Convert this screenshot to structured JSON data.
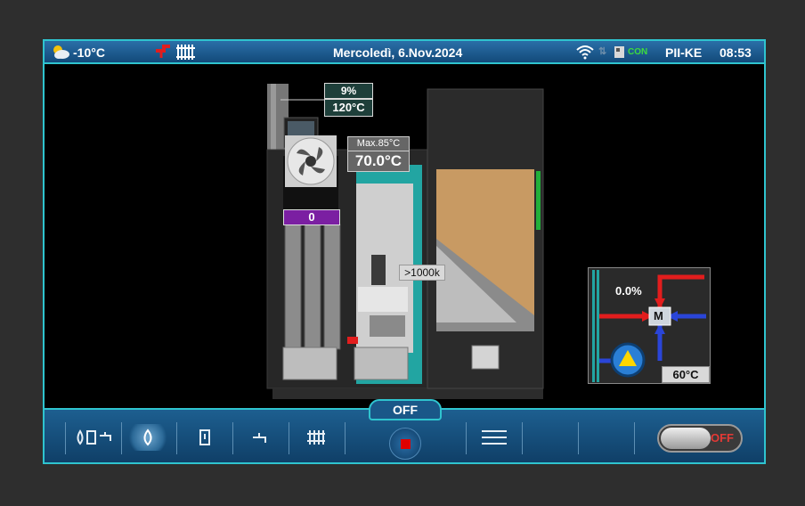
{
  "header": {
    "weather_temp": "-10°C",
    "date": "Mercoledì, 6.Nov.2024",
    "con_label": "CON",
    "model": "PII-KE",
    "time": "08:53"
  },
  "boiler": {
    "flue_percent": "9%",
    "flue_temp": "120°C",
    "max_temp": "Max.85°C",
    "boiler_temp": "70.0°C",
    "fan_speed": "0",
    "sensor_reading": ">1000k"
  },
  "mixer": {
    "valve_percent": "0.0%",
    "motor_label": "M",
    "supply_temp": "60°C"
  },
  "footer": {
    "status": "OFF",
    "switch_label": "OFF"
  },
  "colors": {
    "accent": "#2fc4cf",
    "fan_bar": "#7b1fa2",
    "switch_off": "#e53935",
    "stop_button": "#e00000"
  },
  "icons": {
    "weather": "cloud-sun-icon",
    "heating": "tap-radiator-icon",
    "wifi": "wifi-icon",
    "signal": "signal-arrows-icon",
    "connection": "device-connection-icon"
  }
}
